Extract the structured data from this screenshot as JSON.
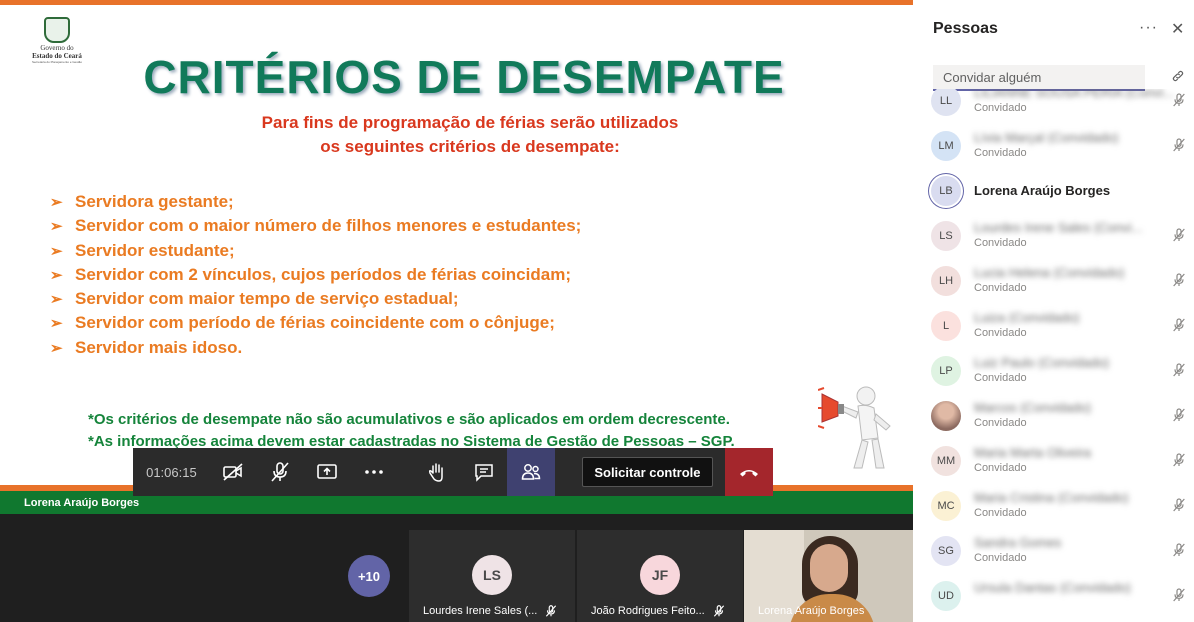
{
  "slide": {
    "logo": {
      "line1": "Governo do",
      "line2": "Estado do Ceará",
      "line3": "Secretaria do Planejamento e Gestão"
    },
    "title": "CRITÉRIOS DE DESEMPATE",
    "subtitle_line1": "Para fins de programação de férias serão utilizados",
    "subtitle_line2": "os seguintes critérios de desempate:",
    "bullet_glyph": "➢",
    "criteria": [
      "Servidora gestante;",
      "Servidor com o maior número de filhos menores e estudantes;",
      "Servidor estudante;",
      "Servidor com 2 vínculos, cujos períodos de férias coincidam;",
      "Servidor com maior tempo de serviço estadual;",
      "Servidor com período de férias coincidente com o cônjuge;",
      "Servidor mais idoso."
    ],
    "note1": "*Os critérios de desempate não são acumulativos e são aplicados em ordem decrescente.",
    "note2": "*As informações acima devem estar cadastradas no Sistema de Gestão de Pessoas – SGP."
  },
  "presenter_name": "Lorena Araújo Borges",
  "controls": {
    "timer": "01:06:15",
    "request_control_label": "Solicitar controle",
    "icons": [
      "camera-off-icon",
      "mic-off-icon",
      "share-tray-icon",
      "more-options-icon",
      "raise-hand-icon",
      "chat-icon",
      "participants-icon",
      "hang-up-icon"
    ]
  },
  "gallery": {
    "more_count": "+10",
    "tiles": [
      {
        "initials": "LS",
        "name": "Lourdes Irene Sales (...",
        "muted": true
      },
      {
        "initials": "JF",
        "name": "João Rodrigues Feito...",
        "muted": true
      },
      {
        "name": "Lorena Araújo Borges",
        "video": true
      }
    ]
  },
  "panel": {
    "title": "Pessoas",
    "more": "···",
    "close": "✕",
    "invite_placeholder": "Convidar alguém",
    "people": [
      {
        "initials": "LL",
        "name": "LILIANNE SOUSA PERIA (Convi...",
        "role": "Convidado",
        "muted": true
      },
      {
        "initials": "LM",
        "name": "Lívia Marçal (Convidado)",
        "role": "Convidado",
        "muted": true
      },
      {
        "initials": "LB",
        "name": "Lorena Araújo Borges",
        "role": "",
        "muted": false,
        "presenter": true,
        "status": "busy"
      },
      {
        "initials": "LS",
        "name": "Lourdes Irene Sales (Convi...",
        "role": "Convidado",
        "muted": true
      },
      {
        "initials": "LH",
        "name": "Lucia Helena (Convidado)",
        "role": "Convidado",
        "muted": true,
        "status": "busy"
      },
      {
        "initials": "L",
        "name": "Luiza (Convidado)",
        "role": "Convidado",
        "muted": true
      },
      {
        "initials": "LP",
        "name": "Luiz Paulo (Convidado)",
        "role": "Convidado",
        "muted": true
      },
      {
        "initials": "",
        "name": "Marcos (Convidado)",
        "role": "Convidado",
        "muted": true,
        "photo": true
      },
      {
        "initials": "MM",
        "name": "Maria Marta Oliveira",
        "role": "Convidado",
        "muted": true
      },
      {
        "initials": "MC",
        "name": "Maria Cristina (Convidado)",
        "role": "Convidado",
        "muted": true
      },
      {
        "initials": "SG",
        "name": "Sandra Gomes",
        "role": "Convidado",
        "muted": true
      },
      {
        "initials": "UD",
        "name": "Ursula Dantas (Convidado)",
        "role": "",
        "muted": true,
        "status": "offline"
      }
    ]
  },
  "avatar_colors": {
    "LL": "#dfe3f1",
    "LM": "#d4e3f5",
    "LB": "#d9dcf0",
    "LS": "#efe3e6",
    "LH": "#f2dfdd",
    "L": "#fbe1de",
    "LP": "#dff3e2",
    "MM": "#f1e2df",
    "MC": "#fbf1d4",
    "SG": "#e3e4f3",
    "UD": "#dcf1ee",
    "JF": "#f8d7dc"
  },
  "colors": {
    "title_green": "#117a5a",
    "subtitle_red": "#d9381e",
    "criteria_orange": "#ea7b22",
    "note_green": "#15843b",
    "teams_purple": "#6264a7",
    "hangup_red": "#a4262c"
  }
}
